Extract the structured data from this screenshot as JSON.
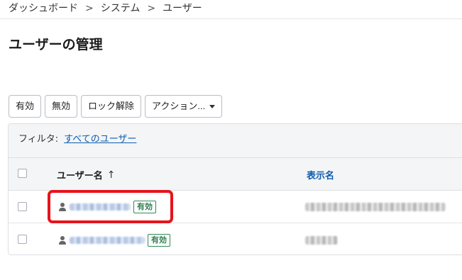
{
  "breadcrumb": {
    "items": [
      "ダッシュボード",
      "システム",
      "ユーザー"
    ],
    "separator": ">"
  },
  "page": {
    "title": "ユーザーの管理"
  },
  "toolbar": {
    "enable_label": "有効",
    "disable_label": "無効",
    "unlock_label": "ロック解除",
    "actions_label": "アクション..."
  },
  "filter": {
    "label": "フィルタ:",
    "value": "すべてのユーザー"
  },
  "table": {
    "columns": {
      "username": "ユーザー名",
      "sort_indicator": "↑",
      "display_name": "表示名"
    },
    "rows": [
      {
        "status": "有効",
        "highlighted": true
      },
      {
        "status": "有効",
        "highlighted": false
      }
    ]
  },
  "colors": {
    "link": "#0b5cad",
    "badge_green": "#2e7d4f",
    "highlight_red": "#e8131b"
  }
}
